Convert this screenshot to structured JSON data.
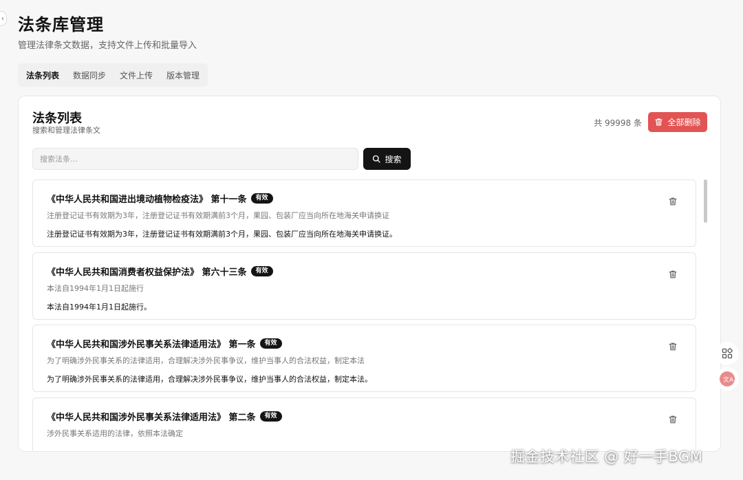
{
  "header": {
    "collapse_glyph": "‹",
    "title": "法条库管理",
    "subtitle": "管理法律条文数据，支持文件上传和批量导入"
  },
  "tabs": [
    {
      "label": "法条列表",
      "active": true
    },
    {
      "label": "数据同步",
      "active": false
    },
    {
      "label": "文件上传",
      "active": false
    },
    {
      "label": "版本管理",
      "active": false
    }
  ],
  "card": {
    "title": "法条列表",
    "subtitle": "搜索和管理法律条文",
    "count_text": "共 99998 条",
    "delete_all_label": "全部删除",
    "delete_all_color": "#e25454"
  },
  "search": {
    "placeholder": "搜索法条...",
    "value": "",
    "button_label": "搜索",
    "icon": "search-icon"
  },
  "laws": [
    {
      "title": "《中华人民共和国进出境动植物检疫法》 第十一条",
      "status": "有效",
      "summary": "注册登记证书有效期为3年，注册登记证书有效期满前3个月，果园、包装厂应当向所在地海关申请换证",
      "content": "注册登记证书有效期为3年，注册登记证书有效期满前3个月，果园、包装厂应当向所在地海关申请换证。"
    },
    {
      "title": "《中华人民共和国消费者权益保护法》 第六十三条",
      "status": "有效",
      "summary": "本法自1994年1月1日起施行",
      "content": "本法自1994年1月1日起施行。"
    },
    {
      "title": "《中华人民共和国涉外民事关系法律适用法》 第一条",
      "status": "有效",
      "summary": "为了明确涉外民事关系的法律适用，合理解决涉外民事争议，维护当事人的合法权益，制定本法",
      "content": "为了明确涉外民事关系的法律适用，合理解决涉外民事争议，维护当事人的合法权益，制定本法。"
    },
    {
      "title": "《中华人民共和国涉外民事关系法律适用法》 第二条",
      "status": "有效",
      "summary": "涉外民事关系适用的法律，依照本法确定",
      "content": ""
    }
  ],
  "side_tools": [
    {
      "icon": "apps-grid-icon"
    },
    {
      "icon": "translate-icon",
      "color": "#e98b8b"
    }
  ],
  "watermark": "掘金技术社区 @ 好一手BGM"
}
